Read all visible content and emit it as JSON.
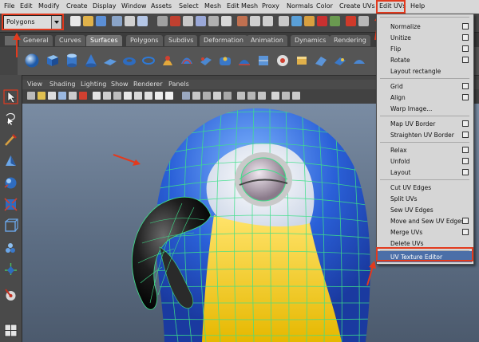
{
  "menubar": {
    "items": [
      "File",
      "Edit",
      "Modify",
      "Create",
      "Display",
      "Window",
      "Assets",
      "Select",
      "Mesh",
      "Edit Mesh",
      "Proxy",
      "Normals",
      "Color",
      "Create UVs",
      "Edit UVs",
      "Help"
    ]
  },
  "statusline": {
    "mode": "Polygons"
  },
  "shelf": {
    "tabs": [
      "General",
      "Curves",
      "Surfaces",
      "Polygons",
      "Subdivs",
      "Deformation",
      "Animation",
      "Dynamics",
      "Rendering"
    ],
    "active_tab": "Surfaces"
  },
  "panel": {
    "menus": [
      "View",
      "Shading",
      "Lighting",
      "Show",
      "Renderer",
      "Panels"
    ]
  },
  "edit_uvs_menu": {
    "items": [
      {
        "label": "Normalize",
        "option_box": true
      },
      {
        "label": "Unitize",
        "option_box": true
      },
      {
        "label": "Flip",
        "option_box": true
      },
      {
        "label": "Rotate",
        "option_box": true
      },
      {
        "label": "Layout rectangle",
        "option_box": false
      },
      {
        "label": "Grid",
        "option_box": true
      },
      {
        "label": "Align",
        "option_box": true
      },
      {
        "label": "Warp Image...",
        "option_box": false
      },
      {
        "label": "Map UV Border",
        "option_box": true
      },
      {
        "label": "Straighten UV Border",
        "option_box": true
      },
      {
        "label": "Relax",
        "option_box": true
      },
      {
        "label": "Unfold",
        "option_box": true
      },
      {
        "label": "Layout",
        "option_box": true
      },
      {
        "label": "Cut UV Edges",
        "option_box": false
      },
      {
        "label": "Split UVs",
        "option_box": false
      },
      {
        "label": "Sew UV Edges",
        "option_box": false
      },
      {
        "label": "Move and Sew UV Edges",
        "option_box": true
      },
      {
        "label": "Merge UVs",
        "option_box": true
      },
      {
        "label": "Delete UVs",
        "option_box": false
      },
      {
        "label": "UV Texture Editor",
        "option_box": false
      }
    ],
    "highlighted": "UV Texture Editor"
  },
  "colors": {
    "annotation_red": "#e23a1e",
    "wireframe": "#3ee08a",
    "menu_bg": "#d6d6d6"
  }
}
